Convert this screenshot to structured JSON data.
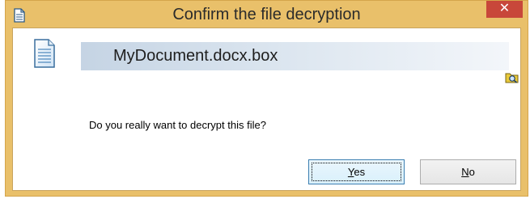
{
  "window": {
    "title": "Confirm the file decryption",
    "close_label": "✕"
  },
  "file": {
    "name": "MyDocument.docx.box"
  },
  "message": "Do you really want to decrypt this file?",
  "buttons": {
    "yes_mnemonic": "Y",
    "yes_rest": "es",
    "no_mnemonic": "N",
    "no_rest": "o"
  },
  "icons": {
    "title": "document-icon",
    "file": "document-icon",
    "browse": "folder-search-icon",
    "close": "close-icon"
  },
  "colors": {
    "frame": "#e9c06a",
    "close": "#c8473a",
    "filename_bar": "#c5d4e4"
  }
}
